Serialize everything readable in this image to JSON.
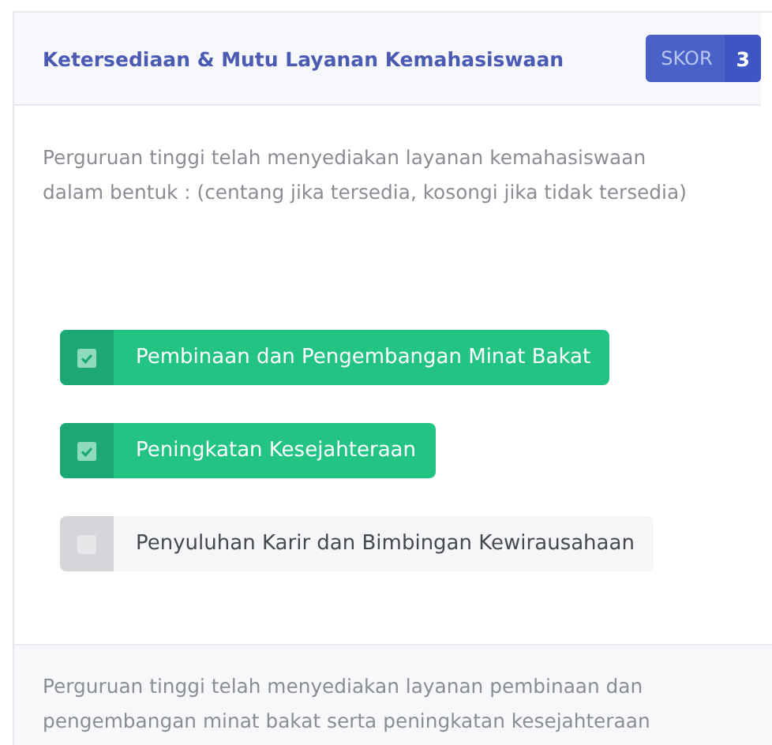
{
  "card": {
    "title": "Ketersediaan & Mutu Layanan Kemahasiswaan",
    "score": {
      "label": "SKOR",
      "value": "3"
    },
    "question": "Perguruan tinggi telah menyediakan layanan kemahasiswaan\ndalam bentuk : (centang jika tersedia, kosongi jika tidak tersedia)",
    "options": [
      {
        "label": "Pembinaan dan Pengembangan Minat Bakat",
        "checked": true
      },
      {
        "label": "Peningkatan Kesejahteraan",
        "checked": true
      },
      {
        "label": "Penyuluhan Karir dan Bimbingan Kewirausahaan",
        "checked": false
      }
    ],
    "footer": "Perguruan tinggi telah menyediakan layanan pembinaan dan\npengembangan minat bakat serta peningkatan kesejahteraan"
  }
}
